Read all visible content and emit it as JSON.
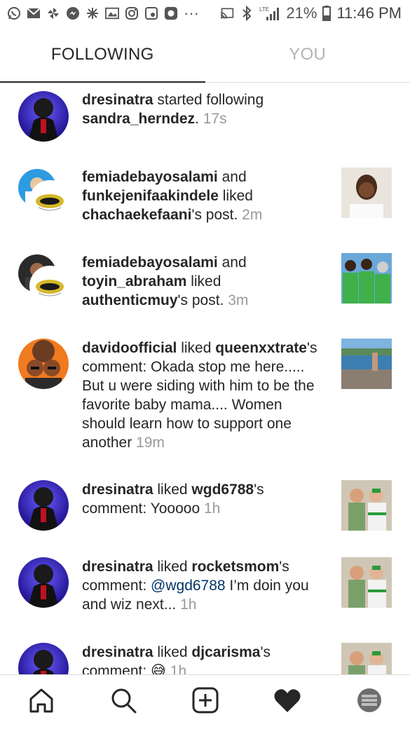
{
  "status_bar": {
    "battery": "21%",
    "time": "11:46 PM",
    "network": "LTE",
    "more": "···",
    "left_icons": [
      "whatsapp-icon",
      "mail-icon",
      "pinwheel-icon",
      "messenger-icon",
      "settings-icon",
      "gallery-icon",
      "instagram-icon",
      "record-icon",
      "app-icon"
    ],
    "right_icons": [
      "cast-icon",
      "bluetooth-icon",
      "signal-icon",
      "battery-icon"
    ]
  },
  "tabs": [
    {
      "label": "FOLLOWING",
      "active": true
    },
    {
      "label": "YOU",
      "active": false
    }
  ],
  "feed": [
    {
      "user": "dresinatra",
      "mid": " started following ",
      "target": "sandra_herndez",
      "tail": ".",
      "time": "17s"
    },
    {
      "user": "femiadebayosalami",
      "mid": " and ",
      "user2": "funkejenifaakindele",
      "mid2": " liked ",
      "target": "chachaekefaani",
      "tail": "'s post.",
      "time": "2m"
    },
    {
      "user": "femiadebayosalami",
      "mid": " and ",
      "user2": "toyin_abraham",
      "mid2": " liked ",
      "target": "authenticmuy",
      "tail": "'s post.",
      "time": "3m"
    },
    {
      "user": "davidoofficial",
      "mid": " liked ",
      "target": "queenxxtrate",
      "tail": "'s comment: Okada stop me here..... But u were siding with him to be the favorite baby mama.... Women should learn how to support one another",
      "time": "19m"
    },
    {
      "user": "dresinatra",
      "mid": " liked ",
      "target": "wgd6788",
      "tail": "'s comment: Yooooo",
      "time": "1h"
    },
    {
      "user": "dresinatra",
      "mid": " liked ",
      "target": "rocketsmom",
      "tail": "'s comment: ",
      "mention": "@wgd6788",
      "tail2": " I’m doin you and wiz next...",
      "time": "1h"
    },
    {
      "user": "dresinatra",
      "mid": " liked ",
      "target": "djcarisma",
      "tail": "'s",
      "line2": "comment: ",
      "emoji": "😅",
      "time": "1h"
    }
  ],
  "bottom_nav": [
    "home-icon",
    "search-icon",
    "add-post-icon",
    "activity-heart-icon",
    "profile-avatar-icon"
  ],
  "colors": {
    "text": "#262626",
    "muted": "#999999",
    "divider": "#dbdbdb",
    "mention": "#003569"
  }
}
